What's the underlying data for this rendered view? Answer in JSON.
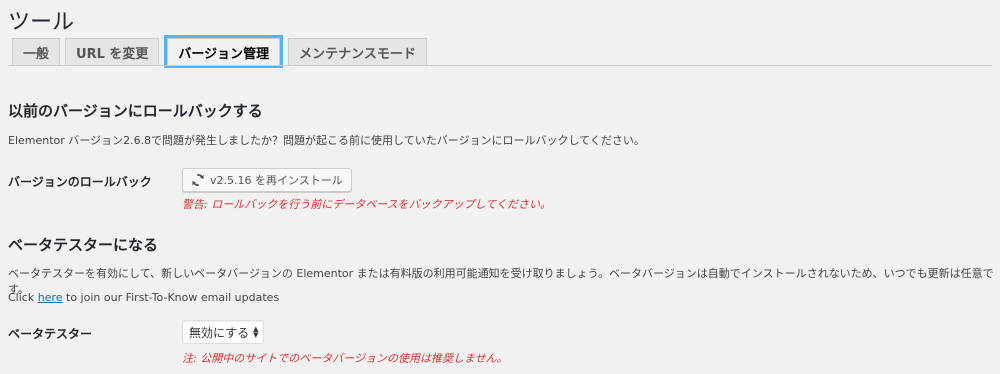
{
  "page": {
    "title": "ツール"
  },
  "tabs": [
    {
      "label": "一般",
      "active": false
    },
    {
      "label": "URL を変更",
      "active": false
    },
    {
      "label": "バージョン管理",
      "active": true
    },
    {
      "label": "メンテナンスモード",
      "active": false
    }
  ],
  "rollback": {
    "heading": "以前のバージョンにロールバックする",
    "description": "Elementor バージョン2.6.8で問題が発生しましたか？問題が起こる前に使用していたバージョンにロールバックしてください。",
    "row_label": "バージョンのロールバック",
    "button_label": "v2.5.16 を再インストール",
    "button_icon": "reload-icon",
    "warning": "警告: ロールバックを行う前にデータベースをバックアップしてください。"
  },
  "beta": {
    "heading": "ベータテスターになる",
    "description": "ベータテスターを有効にして、新しいベータバージョンの Elementor または有料版の利用可能通知を受け取りましょう。ベータバージョンは自動でインストールされないため、いつでも更新は任意です。",
    "click_prefix": "Click ",
    "click_link": "here",
    "click_suffix": " to join our First-To-Know email updates",
    "row_label": "ベータテスター",
    "select_value": "無効にする",
    "note": "注: 公開中のサイトでのベータバージョンの使用は推奨しません。"
  },
  "colors": {
    "background": "#f1f1f1",
    "active_tab_outline": "#5bb2e8",
    "warning": "#dc3232",
    "link": "#0073aa"
  }
}
